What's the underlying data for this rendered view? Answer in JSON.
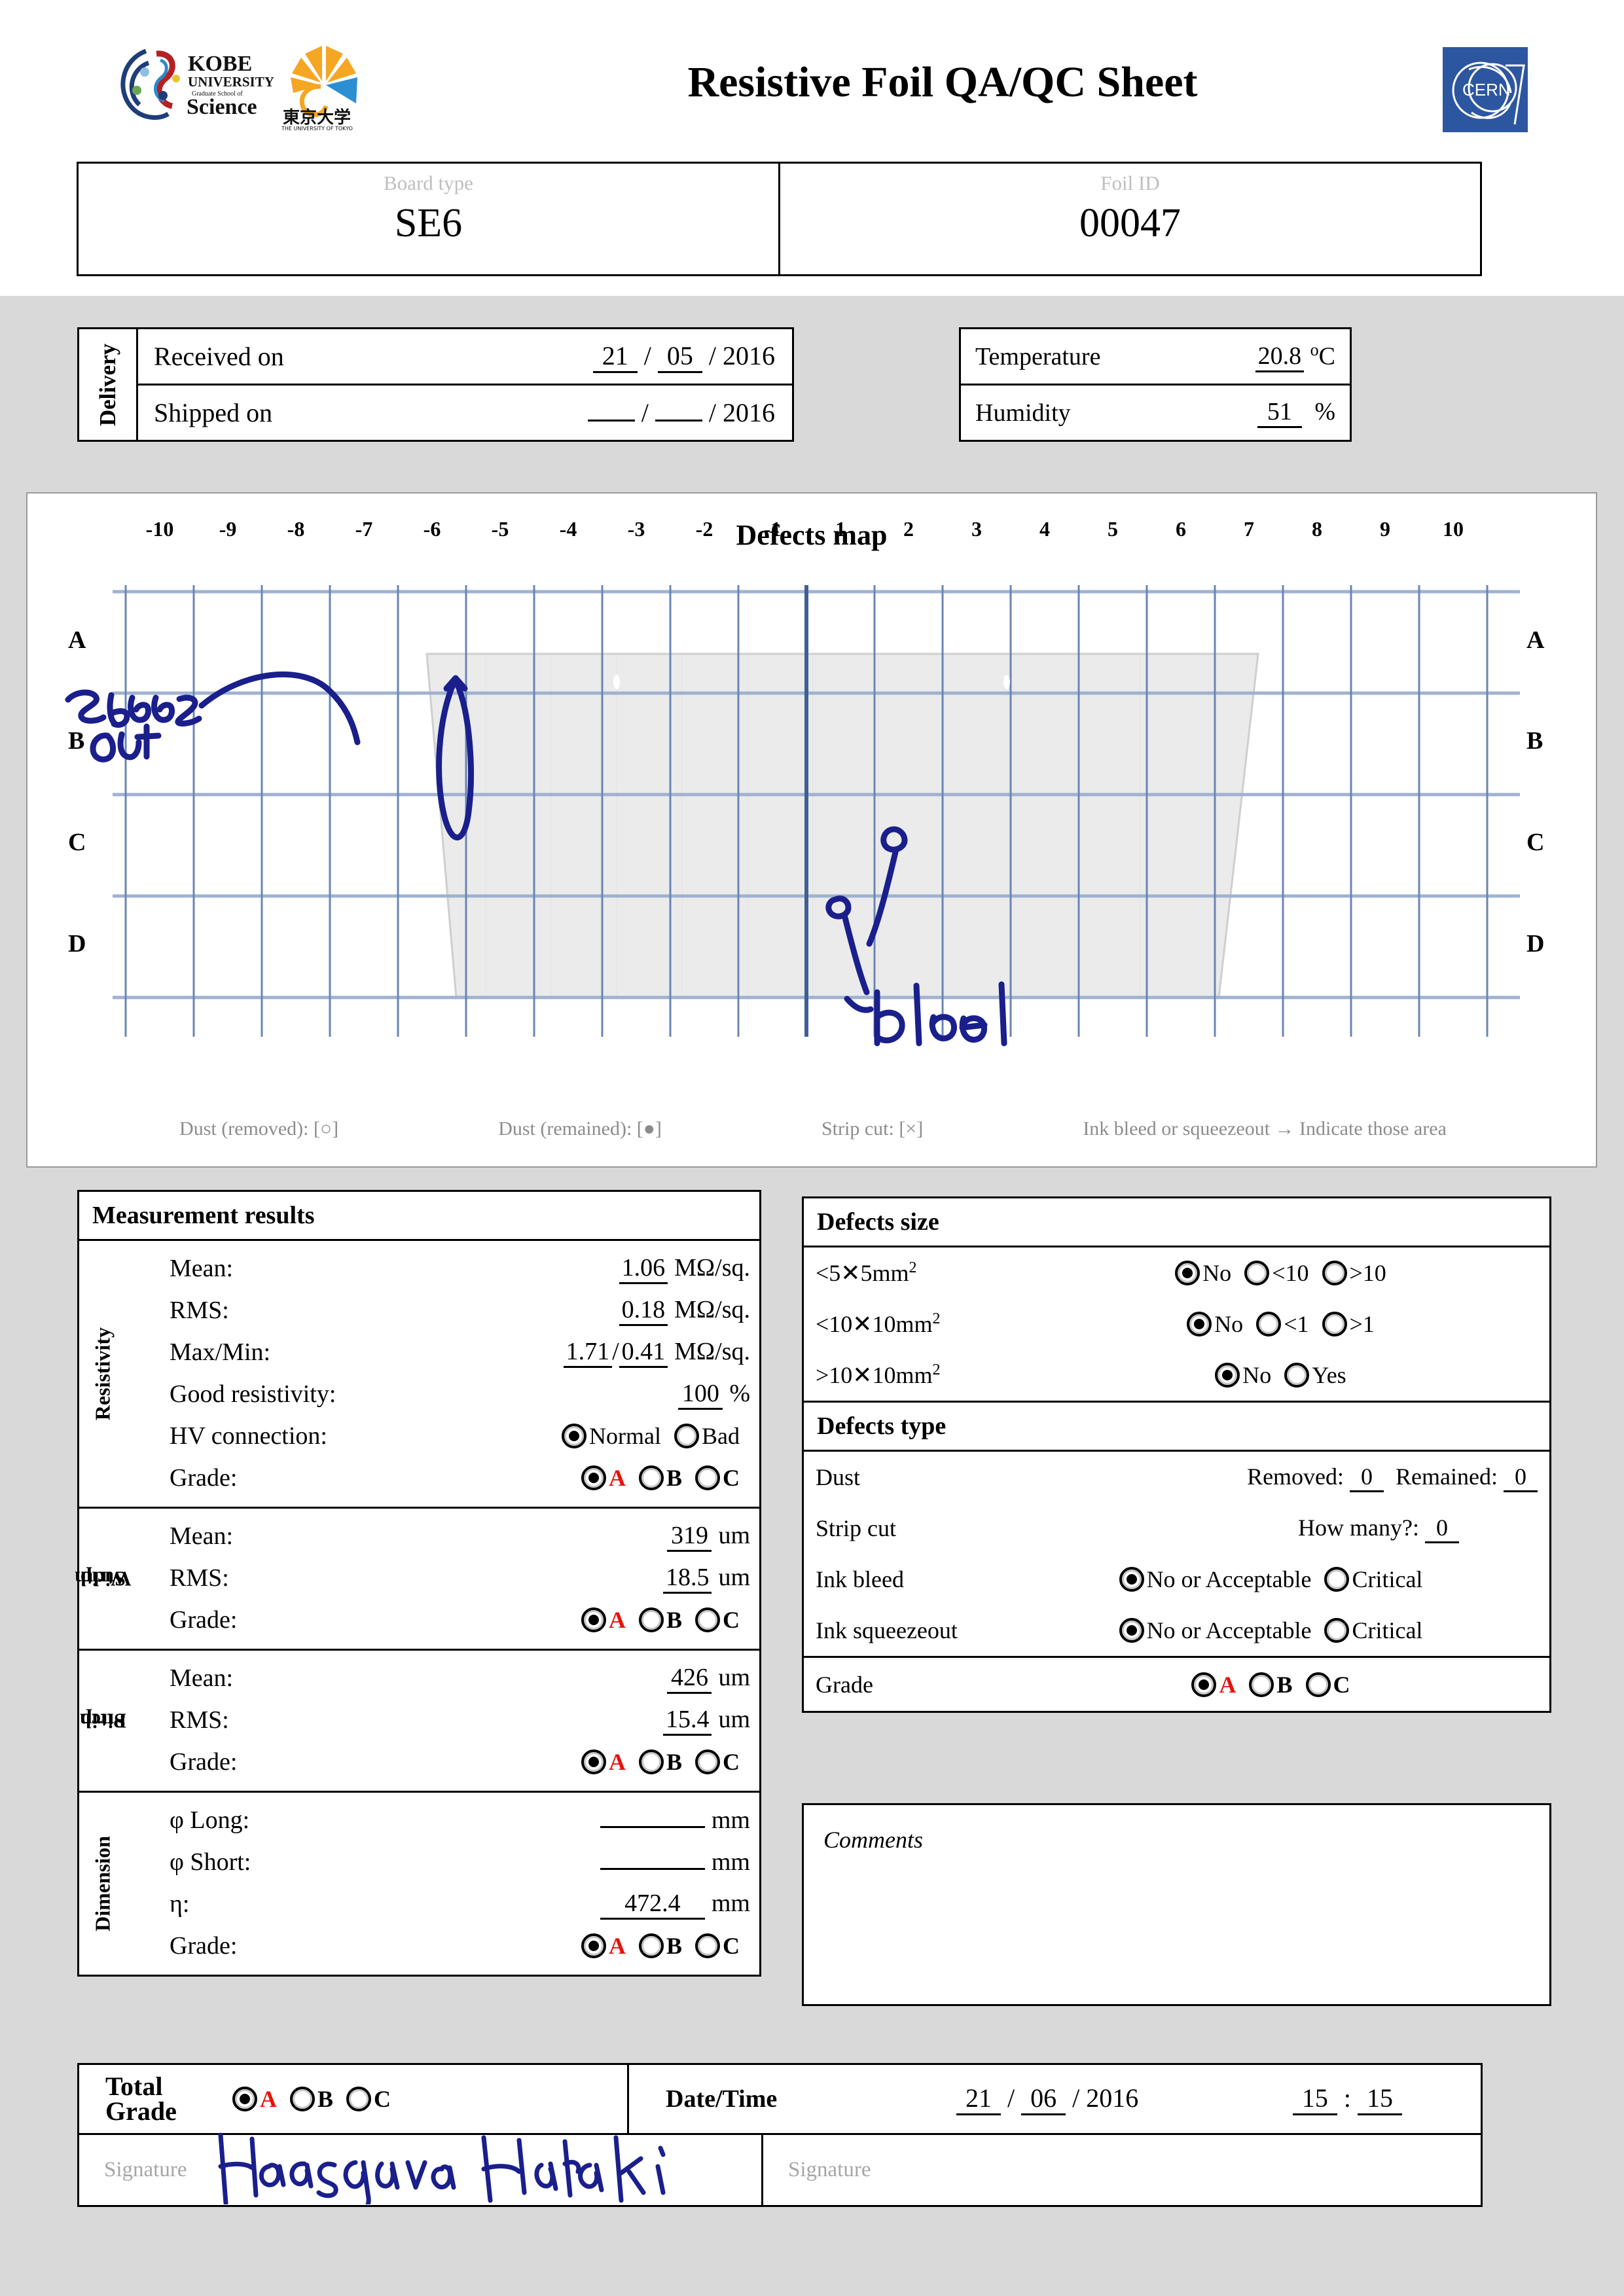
{
  "header": {
    "title": "Resistive Foil QA/QC Sheet",
    "logos": {
      "kobe_line1": "KOBE",
      "kobe_line2": "UNIVERSITY",
      "kobe_line3": "Graduate School of",
      "kobe_line4": "Science",
      "todai_jp": "東京大学",
      "todai_en": "THE UNIVERSITY OF TOKYO",
      "cern": "CERN"
    }
  },
  "identity": {
    "board_type_label": "Board type",
    "board_type_value": "SE6",
    "foil_id_label": "Foil ID",
    "foil_id_value": "00047"
  },
  "delivery": {
    "section_label": "Delivery",
    "received_label": "Received on",
    "received_day": "21",
    "received_month": "05",
    "received_year": "2016",
    "shipped_label": "Shipped on",
    "shipped_day": "",
    "shipped_month": "",
    "shipped_year": "2016",
    "separator": "/"
  },
  "environment": {
    "temperature_label": "Temperature",
    "temperature_value": "20.8",
    "temperature_unit": "C",
    "temperature_degree": "o",
    "humidity_label": "Humidity",
    "humidity_value": "51",
    "humidity_unit": "%"
  },
  "defects_map": {
    "title": "Defects map",
    "columns": [
      "-10",
      "-9",
      "-8",
      "-7",
      "-6",
      "-5",
      "-4",
      "-3",
      "-2",
      "-1",
      "1",
      "2",
      "3",
      "4",
      "5",
      "6",
      "7",
      "8",
      "9",
      "10"
    ],
    "rows": [
      "A",
      "B",
      "C",
      "D"
    ],
    "legend": [
      "Dust (removed): [○]",
      "Dust (remained): [●]",
      "Strip cut: [×]",
      "Ink bleed or squeezeout → Indicate those area"
    ],
    "annotations": [
      {
        "text": "squeeze",
        "kind": "handwriting"
      },
      {
        "text": "out",
        "kind": "handwriting"
      },
      {
        "text": "bleed",
        "kind": "handwriting"
      }
    ],
    "ink_color": "#1a1f8c",
    "grid_color": "#6a85b6",
    "foil_fill": "#ebebeb"
  },
  "measurement": {
    "panel_title": "Measurement results",
    "sections": [
      {
        "label": "Resistivity",
        "rows": [
          {
            "label": "Mean:",
            "value": "1.06",
            "unit": "MΩ/sq."
          },
          {
            "label": "RMS:",
            "value": "0.18",
            "unit": "MΩ/sq."
          },
          {
            "label": "Max/Min:",
            "value": "1.71",
            "value2": "0.41",
            "unit": "MΩ/sq."
          },
          {
            "label": "Good resistivity:",
            "value": "100",
            "unit": "%"
          }
        ],
        "hv_label": "HV connection:",
        "hv_options": [
          "Normal",
          "Bad"
        ],
        "hv_selected": "Normal",
        "grade_label": "Grade:",
        "grade_options": [
          "A",
          "B",
          "C"
        ],
        "grade_selected": "A"
      },
      {
        "label": "Strip Width",
        "label_line1": "Strip",
        "label_line2": "Width",
        "rows": [
          {
            "label": "Mean:",
            "value": "319",
            "unit": "um"
          },
          {
            "label": "RMS:",
            "value": "18.5",
            "unit": "um"
          }
        ],
        "grade_label": "Grade:",
        "grade_options": [
          "A",
          "B",
          "C"
        ],
        "grade_selected": "A"
      },
      {
        "label": "Strip Pitch",
        "label_line1": "Strip",
        "label_line2": "Pitch",
        "rows": [
          {
            "label": "Mean:",
            "value": "426",
            "unit": "um"
          },
          {
            "label": "RMS:",
            "value": "15.4",
            "unit": "um"
          }
        ],
        "grade_label": "Grade:",
        "grade_options": [
          "A",
          "B",
          "C"
        ],
        "grade_selected": "A"
      },
      {
        "label": "Dimension",
        "rows": [
          {
            "label": "φ Long:",
            "value": "",
            "unit": "mm"
          },
          {
            "label": "φ Short:",
            "value": "",
            "unit": "mm"
          },
          {
            "label": "η:",
            "value": "472.4",
            "unit": "mm"
          }
        ],
        "grade_label": "Grade:",
        "grade_options": [
          "A",
          "B",
          "C"
        ],
        "grade_selected": "A"
      }
    ]
  },
  "defects_size": {
    "panel_title": "Defects size",
    "rows": [
      {
        "label": "<5✕5mm",
        "sup": "2",
        "options": [
          "No",
          "<10",
          ">10"
        ],
        "selected": "No"
      },
      {
        "label": "<10✕10mm",
        "sup": "2",
        "options": [
          "No",
          "<1",
          ">1"
        ],
        "selected": "No"
      },
      {
        "label": ">10✕10mm",
        "sup": "2",
        "options": [
          "No",
          "Yes"
        ],
        "selected": "No"
      }
    ]
  },
  "defects_type": {
    "panel_title": "Defects type",
    "dust_label": "Dust",
    "dust_removed_label": "Removed:",
    "dust_removed_value": "0",
    "dust_remained_label": "Remained:",
    "dust_remained_value": "0",
    "stripcut_label": "Strip cut",
    "stripcut_question": "How many?:",
    "stripcut_value": "0",
    "inkbleed_label": "Ink bleed",
    "inkbleed_options": [
      "No or Acceptable",
      "Critical"
    ],
    "inkbleed_selected": "No or Acceptable",
    "squeezeout_label": "Ink squeezeout",
    "squeezeout_options": [
      "No or Acceptable",
      "Critical"
    ],
    "squeezeout_selected": "No or Acceptable",
    "grade_label": "Grade",
    "grade_options": [
      "A",
      "B",
      "C"
    ],
    "grade_selected": "A"
  },
  "comments": {
    "label": "Comments",
    "value": ""
  },
  "footer": {
    "total_grade_line1": "Total",
    "total_grade_line2": "Grade",
    "total_grade_options": [
      "A",
      "B",
      "C"
    ],
    "total_grade_selected": "A",
    "datetime_label": "Date/Time",
    "date_day": "21",
    "date_month": "06",
    "date_year": "2016",
    "time_hour": "15",
    "time_minute": "15",
    "date_separator": "/",
    "time_separator": ":",
    "signature_label_1": "Signature",
    "signature_value_1": "Hasegawa Hiroaki",
    "signature_label_2": "Signature",
    "signature_value_2": ""
  },
  "colors": {
    "grade_accent": "#e8110b",
    "ink": "#1a1f8c",
    "page_bg": "#d9d9d9",
    "label_gray": "#bfbfbf"
  }
}
